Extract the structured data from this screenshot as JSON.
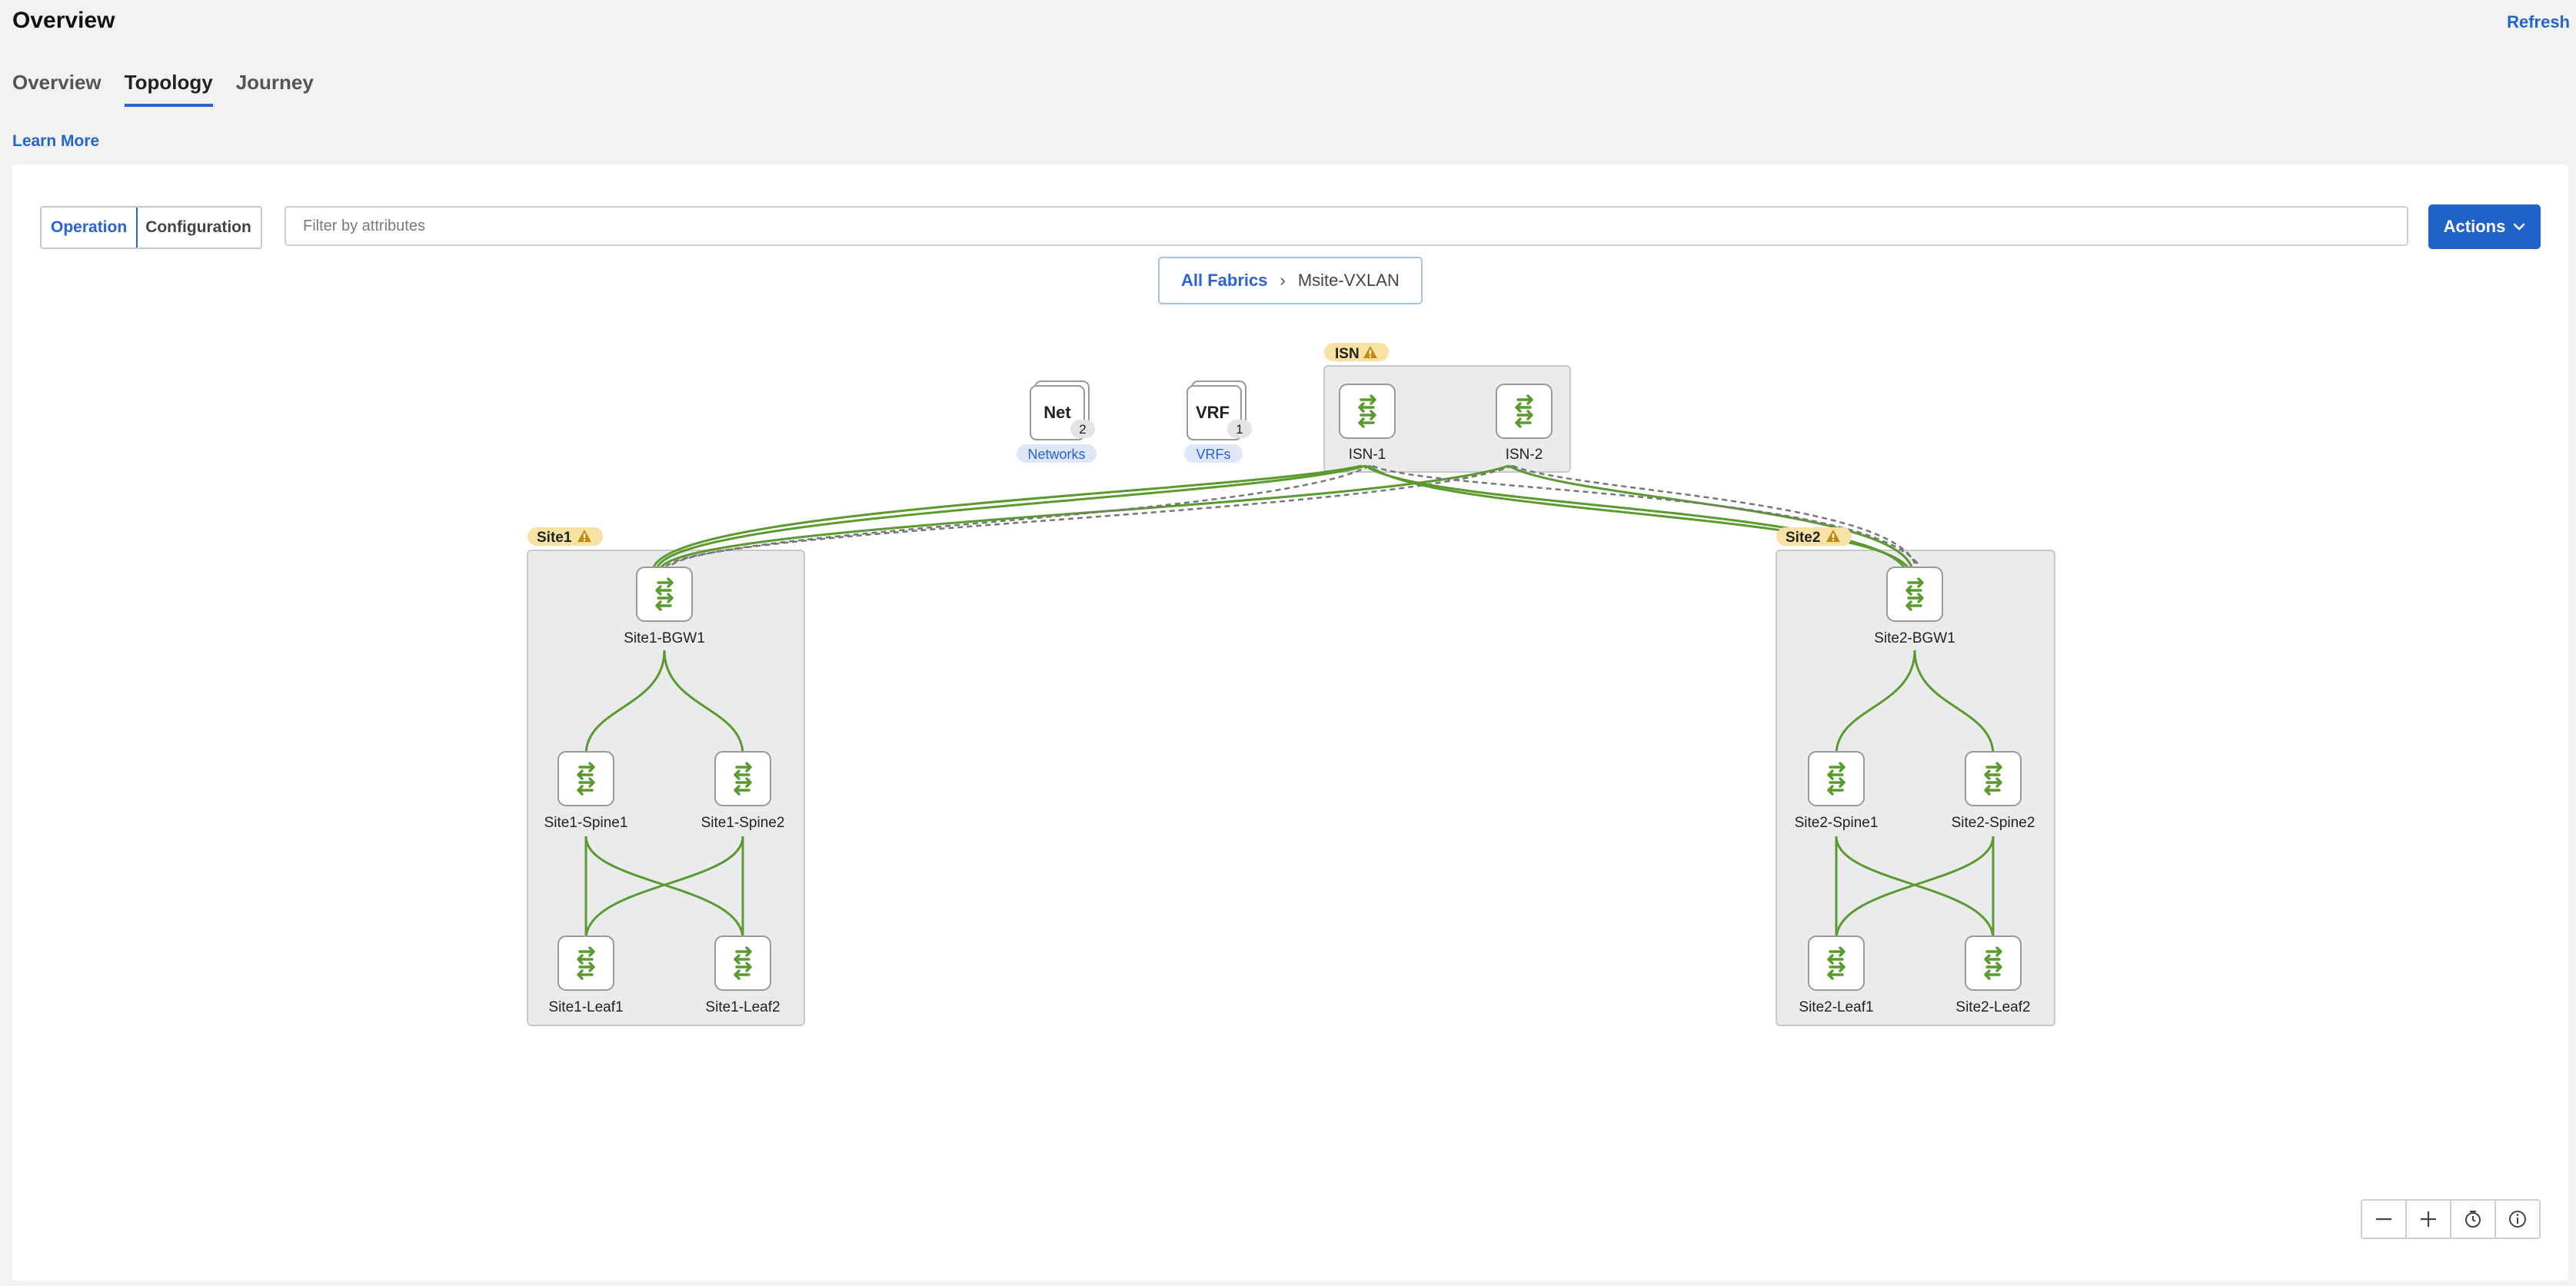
{
  "header": {
    "title": "Overview",
    "refresh_label": "Refresh"
  },
  "tabs": [
    {
      "label": "Overview",
      "active": false
    },
    {
      "label": "Topology",
      "active": true
    },
    {
      "label": "Journey",
      "active": false
    }
  ],
  "learn_more_label": "Learn More",
  "toolbar": {
    "mode_toggle": [
      {
        "label": "Operation",
        "selected": true
      },
      {
        "label": "Configuration",
        "selected": false
      }
    ],
    "filter_placeholder": "Filter by attributes",
    "actions_label": "Actions"
  },
  "breadcrumb": {
    "root": "All Fabrics",
    "separator": "›",
    "current": "Msite-VXLAN"
  },
  "topology": {
    "summary_cards": [
      {
        "abbr": "Net",
        "count": "2",
        "label": "Networks"
      },
      {
        "abbr": "VRF",
        "count": "1",
        "label": "VRFs"
      }
    ],
    "groups": [
      {
        "name": "ISN",
        "warning": true
      },
      {
        "name": "Site1",
        "warning": true
      },
      {
        "name": "Site2",
        "warning": true
      }
    ],
    "devices": {
      "isn1": "ISN-1",
      "isn2": "ISN-2",
      "s1_bgw1": "Site1-BGW1",
      "s1_spine1": "Site1-Spine1",
      "s1_spine2": "Site1-Spine2",
      "s1_leaf1": "Site1-Leaf1",
      "s1_leaf2": "Site1-Leaf2",
      "s2_bgw1": "Site2-BGW1",
      "s2_spine1": "Site2-Spine1",
      "s2_spine2": "Site2-Spine2",
      "s2_leaf1": "Site2-Leaf1",
      "s2_leaf2": "Site2-Leaf2"
    }
  },
  "zoom_controls": [
    {
      "icon": "zoom-out-icon"
    },
    {
      "icon": "zoom-in-icon"
    },
    {
      "icon": "reset-view-icon"
    },
    {
      "icon": "info-icon"
    }
  ],
  "colors": {
    "accent": "#1f63c9",
    "link_up": "#5b9a2e",
    "link_down": "#777777",
    "warning_badge": "#f6e2a3",
    "warning_icon": "#c8870a",
    "group_fill": "#eaebed",
    "device_icon": "#5b9a2e"
  }
}
